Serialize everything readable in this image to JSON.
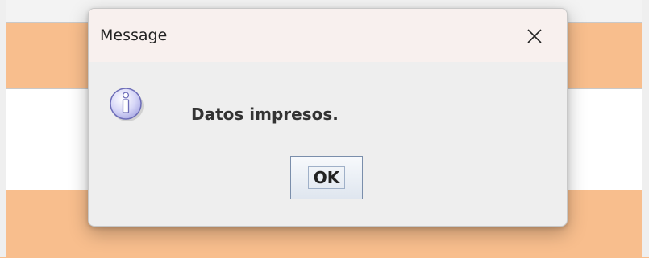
{
  "dialog": {
    "title": "Message",
    "message": "Datos impresos.",
    "ok_label": "OK",
    "icon": "information-icon"
  },
  "colors": {
    "background_band": "#f8be8d",
    "dialog_bg": "#eeeeee",
    "titlebar_bg": "#f8f0ee",
    "icon_fill": "#cfcff5",
    "icon_stroke": "#6d6db8"
  }
}
